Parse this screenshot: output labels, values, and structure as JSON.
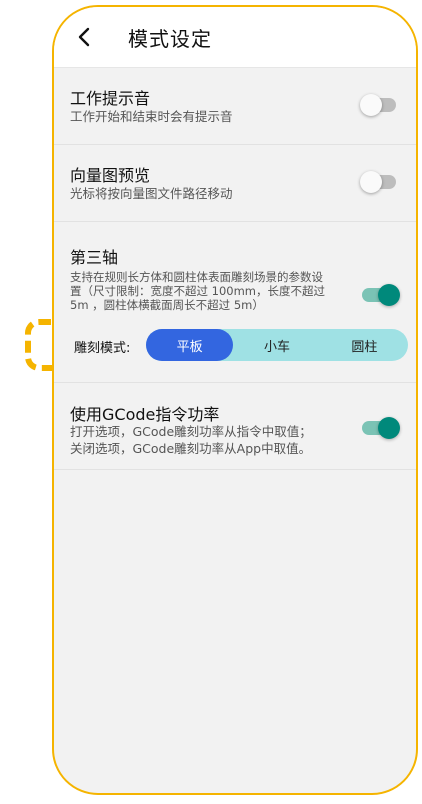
{
  "header": {
    "back_icon": "chevron-left-icon",
    "title": "模式设定"
  },
  "settings": {
    "sound": {
      "title": "工作提示音",
      "subtitle": "工作开始和结束时会有提示音",
      "enabled": false
    },
    "vector_preview": {
      "title": "向量图预览",
      "subtitle": "光标将按向量图文件路径移动",
      "enabled": false
    },
    "third_axis": {
      "title": "第三轴",
      "desc_line1": "支持在规则长方体和圆柱体表面雕刻场景的参数设",
      "desc_line2": "置（尺寸限制：宽度不超过 100mm，长度不超过",
      "desc_line3": "5m ，圆柱体横截面周长不超过 5m）",
      "enabled": true,
      "mode_label": "雕刻模式:",
      "modes": [
        "平板",
        "小车",
        "圆柱"
      ],
      "selected_mode": "平板"
    },
    "gcode_power": {
      "title": "使用GCode指令功率",
      "desc_line1": "打开选项，GCode雕刻功率从指令中取值；",
      "desc_line2": "关闭选项，GCode雕刻功率从App中取值。",
      "enabled": true
    }
  },
  "colors": {
    "frame": "#f5b400",
    "toggle_on": "#00897b",
    "segment_active": "#3366e0",
    "segment_bg": "#9fe1e4"
  }
}
